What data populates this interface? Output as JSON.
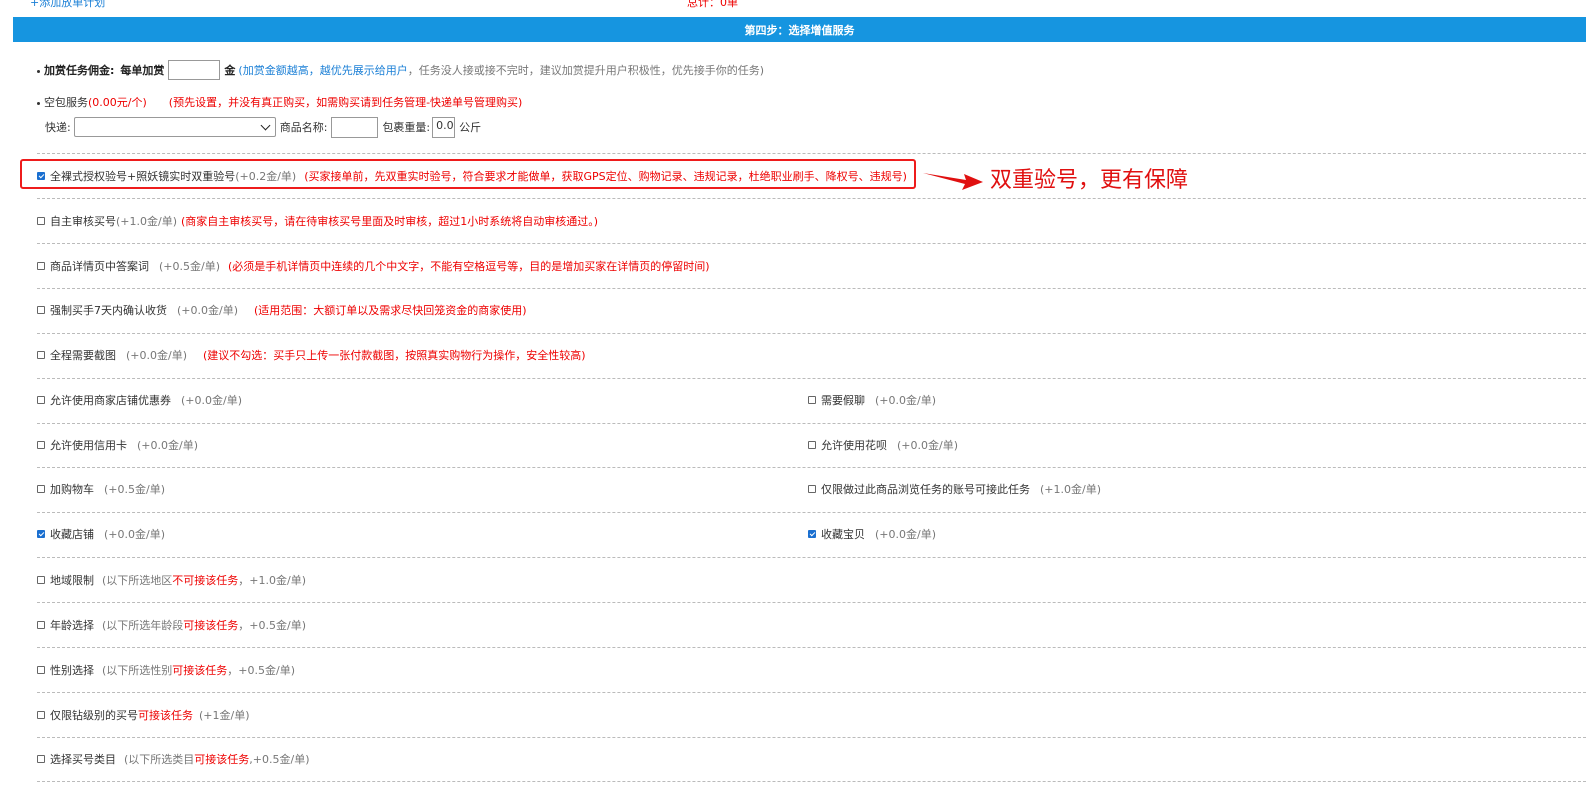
{
  "top": {
    "add_plan_link": "+添加放单计划",
    "total_label": "总计：0单"
  },
  "step_title": "第四步：选择增值服务",
  "reward": {
    "label": "加赏任务佣金:",
    "per_order_label": "每单加赏",
    "input_value": "",
    "unit": "金",
    "hint_blue": "(加赏金额越高，越优先展示给用户",
    "hint_gray": "，任务没人接或接不完时，建议加赏提升用户积极性，优先接手你的任务)"
  },
  "empty_package": {
    "label": "空包服务",
    "price": "(0.00元/个)",
    "note": "(预先设置，并没有真正购买，如需购买请到任务管理-快递单号管理购买)",
    "courier_label": "快递:",
    "courier_value": "",
    "product_label": "商品名称:",
    "product_value": "",
    "weight_label": "包裹重量:",
    "weight_value": "0.0",
    "weight_unit": "公斤"
  },
  "options": {
    "dual_verify": {
      "label": "全裸式授权验号+照妖镜实时双重验号",
      "price": "(+0.2金/单)",
      "note": "(买家接单前，先双重实时验号，符合要求才能做单，获取GPS定位、购物记录、违规记录，杜绝职业刷手、降权号、违规号)",
      "checked": true
    },
    "self_review": {
      "label": "自主审核买号",
      "price": "(+1.0金/单)",
      "note": "(商家自主审核买号，请在待审核买号里面及时审核，超过1小时系统将自动审核通过。)",
      "checked": false
    },
    "answer_keyword": {
      "label": "商品详情页中答案词",
      "price": "(+0.5金/单)",
      "note": "(必须是手机详情页中连续的几个中文字，不能有空格逗号等，目的是增加买家在详情页的停留时间)",
      "checked": false
    },
    "force_confirm": {
      "label": "强制买手7天内确认收货",
      "price": "(+0.0金/单)",
      "note": "(适用范围：大额订单以及需求尽快回笼资金的商家使用)",
      "checked": false
    },
    "screenshot": {
      "label": "全程需要截图",
      "price": "(+0.0金/单)",
      "note": "(建议不勾选：买手只上传一张付款截图，按照真实购物行为操作，安全性较高)",
      "checked": false
    },
    "shop_coupon": {
      "label": "允许使用商家店铺优惠券",
      "price": "(+0.0金/单)",
      "checked": false
    },
    "fake_chat": {
      "label": "需要假聊",
      "price": "(+0.0金/单)",
      "checked": false
    },
    "credit_card": {
      "label": "允许使用信用卡",
      "price": "(+0.0金/单)",
      "checked": false
    },
    "huabei": {
      "label": "允许使用花呗",
      "price": "(+0.0金/单)",
      "checked": false
    },
    "add_cart": {
      "label": "加购物车",
      "price": "(+0.5金/单)",
      "checked": false
    },
    "browse_only": {
      "label": "仅限做过此商品浏览任务的账号可接此任务",
      "price": "(+1.0金/单)",
      "checked": false
    },
    "fav_shop": {
      "label": "收藏店铺",
      "price": "(+0.0金/单)",
      "checked": true
    },
    "fav_item": {
      "label": "收藏宝贝",
      "price": "(+0.0金/单)",
      "checked": true
    },
    "region": {
      "label": "地域限制",
      "pre": "(以下所选地区",
      "mid": "不可接该任务",
      "post": "，+1.0金/单)",
      "checked": false
    },
    "age": {
      "label": "年龄选择",
      "pre": "(以下所选年龄段",
      "mid": "可接该任务",
      "post": "，+0.5金/单)",
      "checked": false
    },
    "gender": {
      "label": "性别选择",
      "pre": "(以下所选性别",
      "mid": "可接该任务",
      "post": "，+0.5金/单)",
      "checked": false
    },
    "diamond": {
      "label": "仅限钻级别的买号",
      "mid": "可接该任务",
      "post": "(+1金/单)",
      "checked": false
    },
    "category": {
      "label": "选择买号类目",
      "pre": "(以下所选类目",
      "mid": "可接该任务",
      "post": ",+0.5金/单)",
      "checked": false
    }
  },
  "callout_text": "双重验号，更有保障",
  "colors": {
    "step_bar": "#1695e0",
    "highlight": "#ee1c1c",
    "link": "#1a7fd6",
    "warn": "#e00000"
  }
}
